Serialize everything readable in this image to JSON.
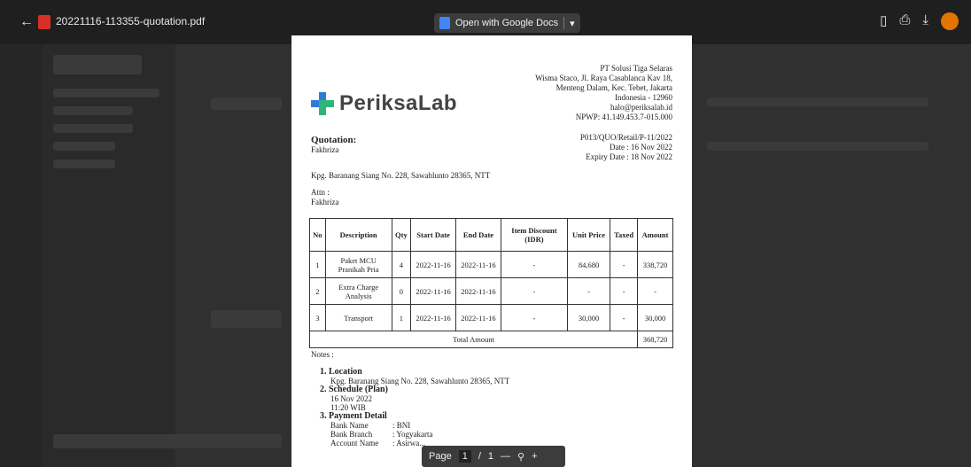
{
  "viewer": {
    "file_name": "20221116-113355-quotation.pdf",
    "open_with": "Open with Google Docs"
  },
  "doc": {
    "logo_text": "PeriksaLab",
    "company_lines": [
      "PT Solusi Tiga Selaras",
      "Wisma Staco, Jl. Raya Casablanca Kav 18,",
      "Menteng Dalam, Kec. Tebet, Jakarta",
      "Indonesia - 12960",
      "halo@periksalab.id",
      "NPWP: 41.149.453.7-015.000"
    ],
    "quotation_label": "Quotation:",
    "client": "Fakhriza",
    "ref": "P013/QUO/Retail/P-11/2022",
    "date": "Date : 16 Nov 2022",
    "expiry": "Expiry Date : 18 Nov 2022",
    "address": "Kpg. Baranang Siang No. 228, Sawahlunto 28365, NTT",
    "attn_label": "Attn :",
    "attn_name": "Fakhriza",
    "table": {
      "headers": [
        "No",
        "Description",
        "Qty",
        "Start Date",
        "End Date",
        "Item Discount (IDR)",
        "Unit Price",
        "Taxed",
        "Amount"
      ],
      "rows": [
        [
          "1",
          "Paket MCU Pranikah Pria",
          "4",
          "2022-11-16",
          "2022-11-16",
          "-",
          "84,680",
          "-",
          "338,720"
        ],
        [
          "2",
          "Extra Charge Analysis",
          "0",
          "2022-11-16",
          "2022-11-16",
          "-",
          "-",
          "-",
          "-"
        ],
        [
          "3",
          "Transport",
          "1",
          "2022-11-16",
          "2022-11-16",
          "-",
          "30,000",
          "-",
          "30,000"
        ]
      ],
      "total_label": "Total Amount",
      "total_value": "368,720"
    },
    "notes_label": "Notes :",
    "notes": {
      "location_h": "1. Location",
      "location": "Kpg. Baranang Siang No. 228, Sawahlunto 28365, NTT",
      "schedule_h": "2. Schedule (Plan)",
      "schedule_date": "16 Nov 2022",
      "schedule_time": "11:20 WIB",
      "payment_h": "3. Payment Detail",
      "bank_name_k": "Bank Name",
      "bank_name_v": ": BNI",
      "bank_branch_k": "Bank Branch",
      "bank_branch_v": ": Yogyakarta",
      "account_name_k": "Account Name",
      "account_name_v": ": Asirwa..."
    }
  },
  "pager": {
    "label": "Page",
    "current": "1",
    "sep": "/",
    "total": "1"
  }
}
